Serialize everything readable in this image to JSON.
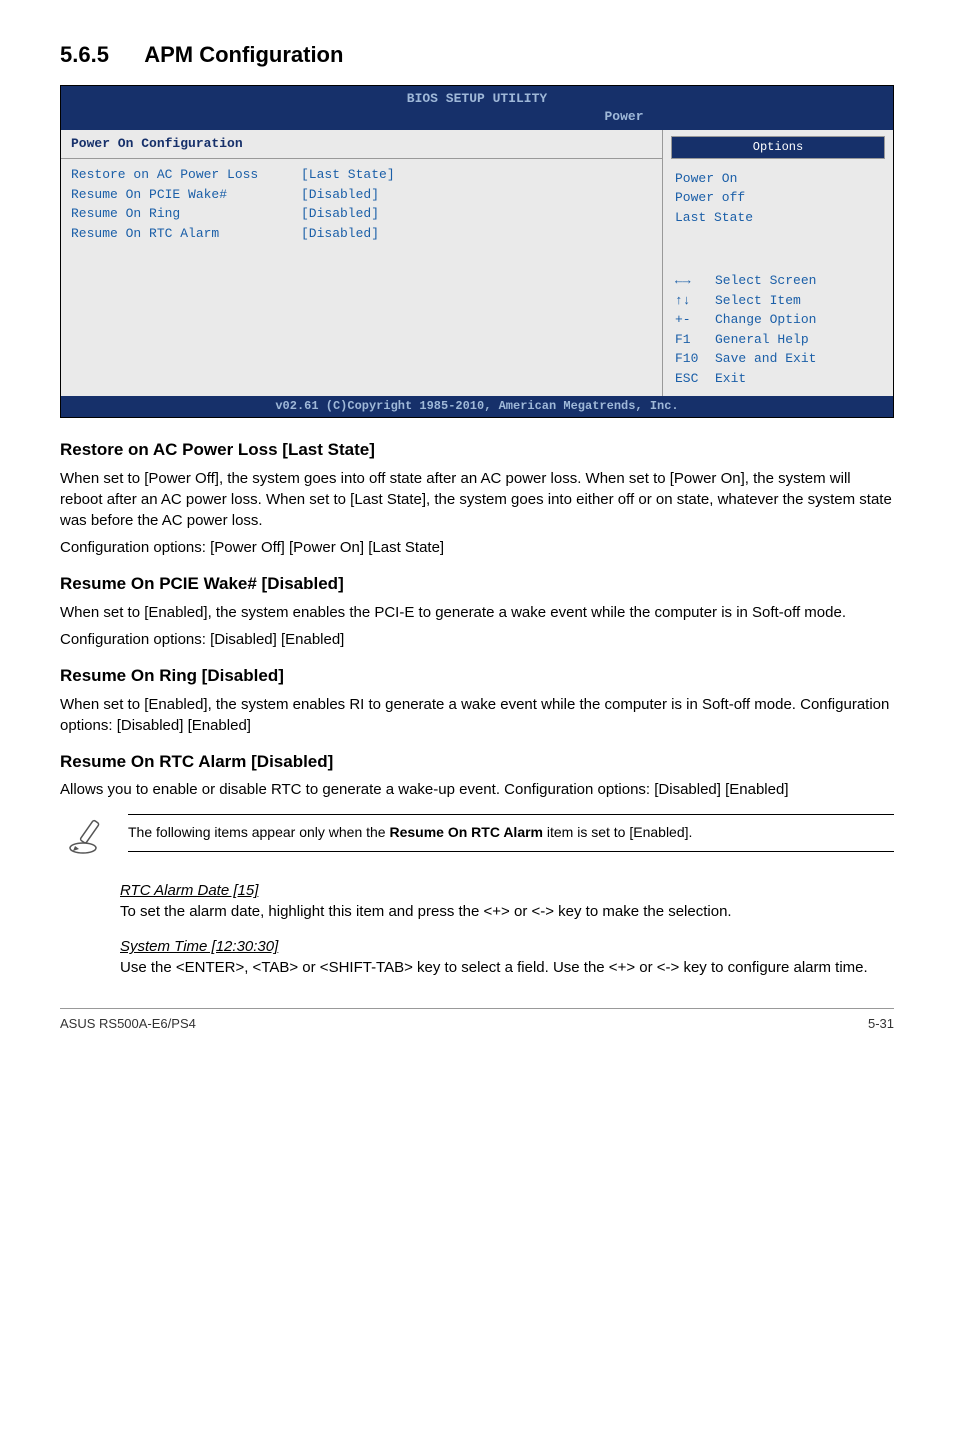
{
  "section": {
    "number": "5.6.5",
    "title": "APM Configuration"
  },
  "bios": {
    "header": "BIOS SETUP UTILITY",
    "tab": "Power",
    "left_header": "Power On Configuration",
    "rows": [
      {
        "label": "Restore on AC Power Loss",
        "value": "[Last State]"
      },
      {
        "label": "",
        "value": ""
      },
      {
        "label": "Resume On PCIE Wake#",
        "value": "[Disabled]"
      },
      {
        "label": "Resume On Ring",
        "value": "[Disabled]"
      },
      {
        "label": "Resume On RTC Alarm",
        "value": "[Disabled]"
      }
    ],
    "options_header": "Options",
    "options": [
      "Power On",
      "Power off",
      "Last State"
    ],
    "help": [
      {
        "key": "←→",
        "desc": "Select Screen"
      },
      {
        "key": "↑↓",
        "desc": "Select Item"
      },
      {
        "key": "+-",
        "desc": "Change Option"
      },
      {
        "key": "F1",
        "desc": "General Help"
      },
      {
        "key": "F10",
        "desc": "Save and Exit"
      },
      {
        "key": "ESC",
        "desc": "Exit"
      }
    ],
    "footer": "v02.61 (C)Copyright 1985-2010, American Megatrends, Inc."
  },
  "s1": {
    "title": "Restore on AC Power Loss [Last State]",
    "p1": "When set to [Power Off], the system goes into off state after an AC power loss. When set to [Power On], the system will reboot after an AC power loss. When set to [Last State], the system goes into either off or on state, whatever the system state was before the AC power loss.",
    "p2": "Configuration options: [Power Off] [Power On] [Last State]"
  },
  "s2": {
    "title": "Resume On PCIE Wake# [Disabled]",
    "p1": "When set to [Enabled], the system enables the PCI-E to generate a wake event while the computer is in Soft-off mode.",
    "p2": "Configuration options: [Disabled] [Enabled]"
  },
  "s3": {
    "title": "Resume On Ring [Disabled]",
    "p1": "When set to [Enabled], the system enables RI to generate a wake event while the computer is in Soft-off mode. Configuration options: [Disabled] [Enabled]"
  },
  "s4": {
    "title": "Resume On RTC Alarm [Disabled]",
    "p1": "Allows you to enable or disable RTC to generate a wake-up event. Configuration options: [Disabled] [Enabled]"
  },
  "note": {
    "pre": "The following items appear only when the ",
    "bold": "Resume On RTC Alarm",
    "post": " item is set to [Enabled]."
  },
  "rtc": {
    "title": "RTC Alarm Date [15]",
    "body": "To set the alarm date, highlight this item and press the <+> or <-> key to make the selection."
  },
  "systime": {
    "title": "System Time [12:30:30]",
    "body": "Use the <ENTER>, <TAB> or <SHIFT-TAB> key to select a field. Use the <+> or <-> key to configure alarm time."
  },
  "footer": {
    "left": "ASUS RS500A-E6/PS4",
    "right": "5-31"
  }
}
